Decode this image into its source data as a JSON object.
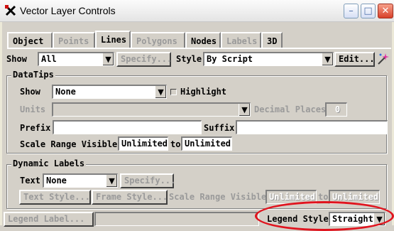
{
  "window": {
    "title": "Vector Layer Controls",
    "app_icon": "vector-app-icon",
    "controls": {
      "minimize": "–",
      "maximize": "□",
      "close": "✕"
    }
  },
  "tabs": [
    {
      "label": "Object",
      "state": "enabled"
    },
    {
      "label": "Points",
      "state": "disabled"
    },
    {
      "label": "Lines",
      "state": "active"
    },
    {
      "label": "Polygons",
      "state": "disabled"
    },
    {
      "label": "Nodes",
      "state": "enabled"
    },
    {
      "label": "Labels",
      "state": "disabled"
    },
    {
      "label": "3D",
      "state": "enabled"
    }
  ],
  "show_row": {
    "show_label": "Show",
    "show_value": "All",
    "specify_label": "Specify...",
    "style_label": "Style",
    "style_value": "By Script",
    "edit_label": "Edit...",
    "wand_icon": "magic-wand-icon"
  },
  "datatips": {
    "legend": "DataTips",
    "show_label": "Show",
    "show_value": "None",
    "highlight_label": "Highlight",
    "units_label": "Units",
    "units_value": "",
    "decimal_label": "Decimal Places",
    "decimal_value": "0",
    "prefix_label": "Prefix",
    "prefix_value": "",
    "suffix_label": "Suffix",
    "suffix_value": "",
    "scale_label": "Scale Range Visible",
    "scale_from": "Unlimited",
    "to_label": "to",
    "scale_to": "Unlimited"
  },
  "dynamic_labels": {
    "legend": "Dynamic Labels",
    "text_label": "Text",
    "text_value": "None",
    "specify_label": "Specify...",
    "text_style_label": "Text Style...",
    "frame_style_label": "Frame Style...",
    "scale_label": "Scale Range Visible",
    "scale_from": "Unlimited",
    "to_label": "to",
    "scale_to": "Unlimited"
  },
  "legend_row": {
    "legend_label_button": "Legend Label...",
    "legend_label_value": "",
    "legend_style_label": "Legend Style",
    "legend_style_value": "Straight",
    "highlight_color": "#e0141e"
  }
}
